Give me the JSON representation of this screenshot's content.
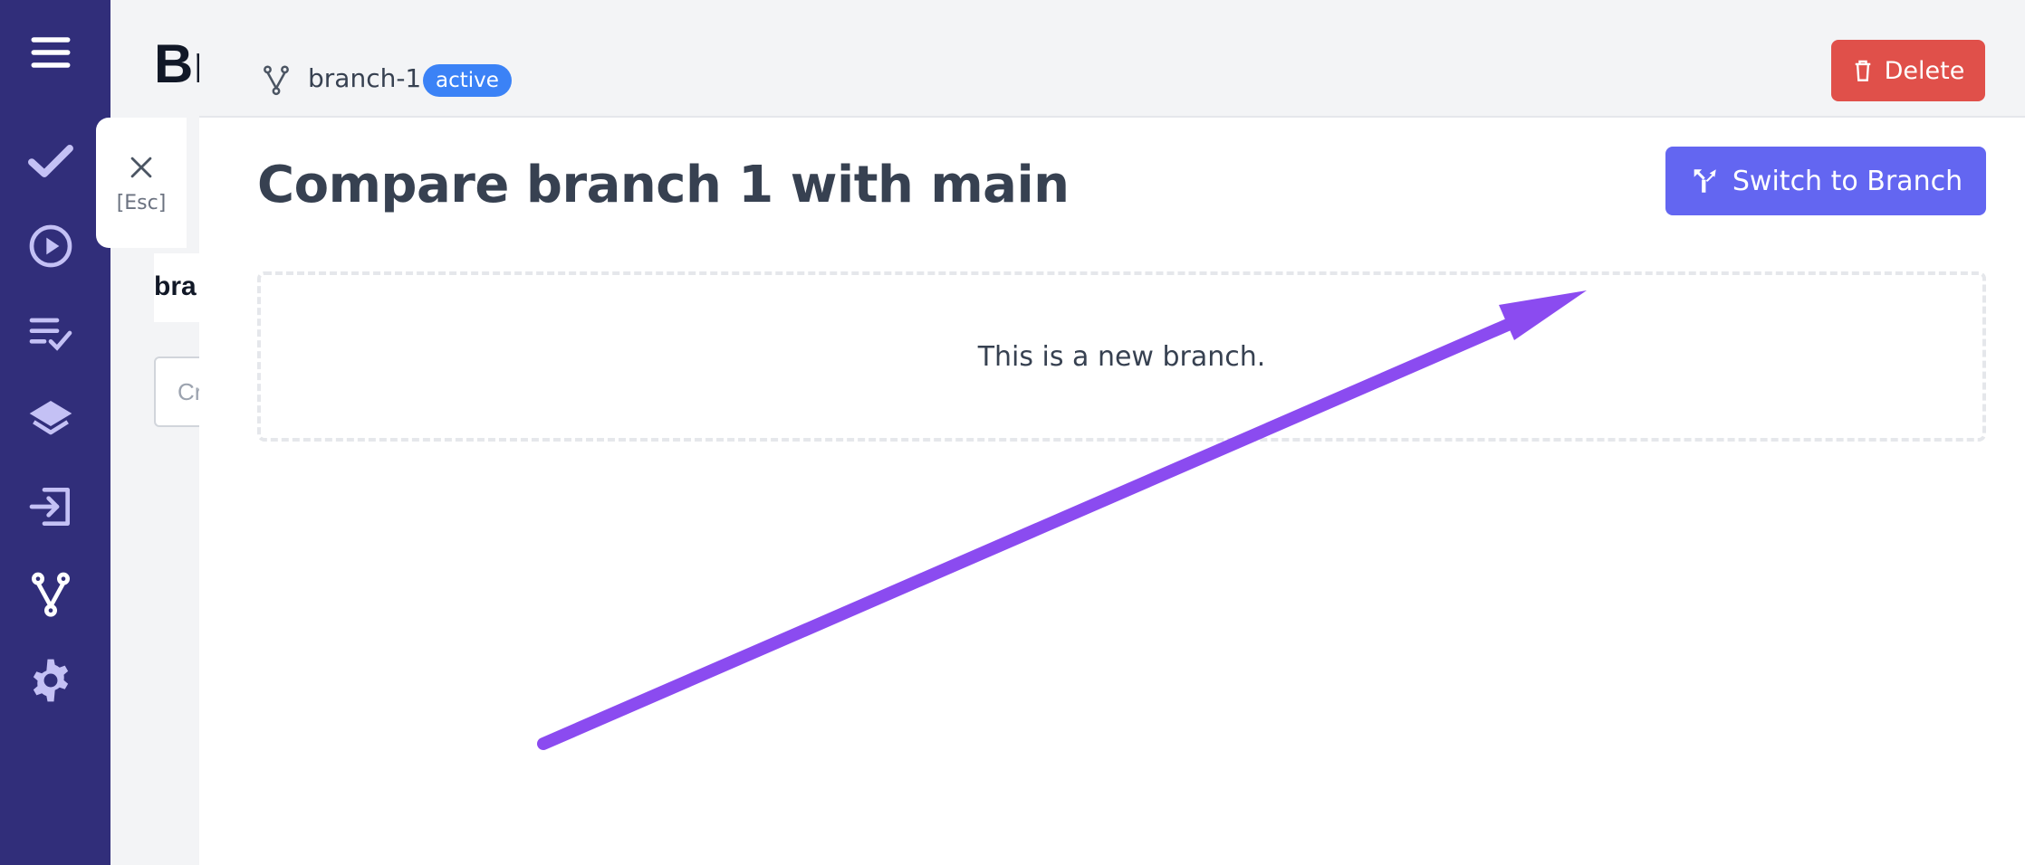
{
  "sidebar": {
    "items": [
      {
        "icon": "menu-icon"
      },
      {
        "icon": "check-icon"
      },
      {
        "icon": "play-circle-icon"
      },
      {
        "icon": "checklist-icon"
      },
      {
        "icon": "layers-icon"
      },
      {
        "icon": "import-icon"
      },
      {
        "icon": "branch-icon"
      },
      {
        "icon": "gear-icon"
      }
    ],
    "background": "#312e7a",
    "icon_color": "#c4c1f5"
  },
  "background_page": {
    "title": "Br",
    "card_label": "bra",
    "input_placeholder": "Cr"
  },
  "close": {
    "esc_label": "[Esc]"
  },
  "panel": {
    "branch_name": "branch-1",
    "status_badge": "active",
    "delete_label": "Delete",
    "title": "Compare branch 1 with main",
    "switch_label": "Switch to Branch",
    "notice": "This is a new branch."
  },
  "colors": {
    "delete": "#e0504a",
    "switch": "#6366f1",
    "badge": "#3b82f6",
    "annotation_arrow": "#8b4bf0"
  }
}
